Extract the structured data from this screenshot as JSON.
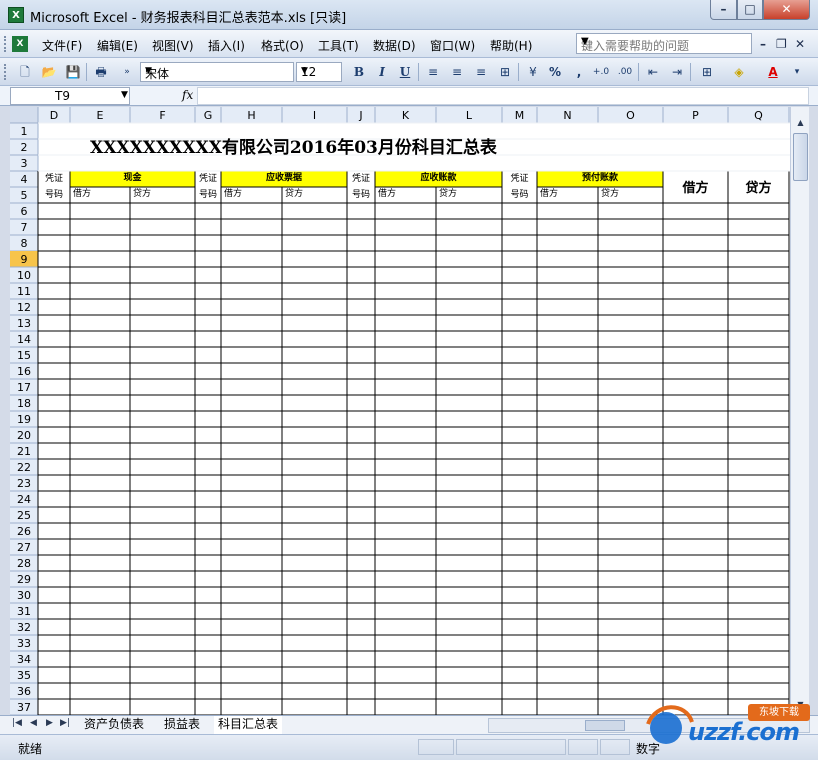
{
  "window": {
    "title": "Microsoft Excel - 财务报表科目汇总表范本.xls  [只读]",
    "app_icon": "excel-icon"
  },
  "menu": {
    "items": [
      "文件(F)",
      "编辑(E)",
      "视图(V)",
      "插入(I)",
      "格式(O)",
      "工具(T)",
      "数据(D)",
      "窗口(W)",
      "帮助(H)"
    ],
    "help_placeholder": "键入需要帮助的问题"
  },
  "toolbar": {
    "font_name": "宋体",
    "font_size": "12",
    "bold": "B",
    "italic": "I",
    "underline": "U",
    "percent": "%",
    "comma": ",",
    "font_color_label": "A"
  },
  "formula_bar": {
    "name_box": "T9",
    "fx": "fx",
    "value": ""
  },
  "sheet": {
    "columns": [
      "D",
      "E",
      "F",
      "G",
      "H",
      "I",
      "J",
      "K",
      "L",
      "M",
      "N",
      "O",
      "P",
      "Q"
    ],
    "rows": [
      "1",
      "2",
      "3",
      "4",
      "5",
      "6",
      "7",
      "8",
      "9",
      "10",
      "11",
      "12",
      "13",
      "14",
      "15",
      "16",
      "17",
      "18",
      "19",
      "20",
      "21",
      "22",
      "23",
      "24",
      "25",
      "26",
      "27",
      "28",
      "29",
      "30",
      "31",
      "32",
      "33",
      "34",
      "35",
      "36",
      "37"
    ],
    "selected_row": "9",
    "title": "XXXXXXXXXX有限公司2016年03月份科目汇总表",
    "voucher_label_1": "凭证",
    "voucher_label_2": "号码",
    "groups": [
      "现金",
      "应收票据",
      "应收账款",
      "预付账款"
    ],
    "debit": "借方",
    "credit": "贷方",
    "summary_debit": "借方",
    "summary_credit": "贷方",
    "header_color": "#ffff00",
    "selected_header_color": "#f7c44a"
  },
  "tabs": [
    "资产负债表",
    "损益表",
    "科目汇总表"
  ],
  "active_tab": "科目汇总表",
  "status": {
    "ready": "就绪",
    "mode": "数字"
  },
  "watermark": {
    "brand": "uzzf.com",
    "tag": "东坡下载"
  }
}
